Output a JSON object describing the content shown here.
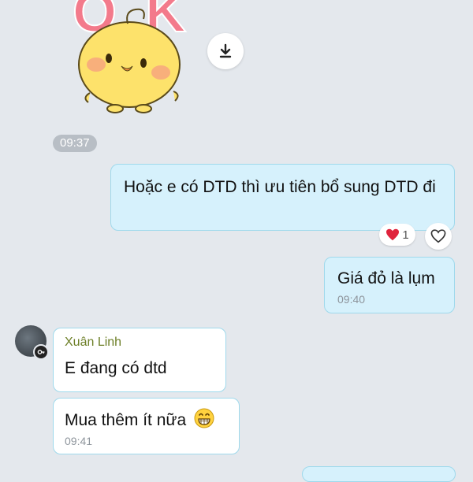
{
  "sticker": {
    "name": "ok-chick-sticker",
    "letters": "OK"
  },
  "download_icon": "download-icon",
  "divider_time": "09:37",
  "messages": [
    {
      "text": "Hoặc e có DTD thì ưu tiên bổ sung DTD đi"
    },
    {
      "text": "Giá đỏ là lụm",
      "time": "09:40"
    },
    {
      "sender": "Xuân Linh",
      "text": "E đang có dtd"
    },
    {
      "text": "Mua thêm ít nữa",
      "emoji": "grinning-face-icon",
      "time": "09:41"
    }
  ],
  "reaction": {
    "icon": "heart-icon",
    "count": "1"
  },
  "like_icon": "heart-outline-icon",
  "colors": {
    "mine_bubble": "#d6f1fc",
    "bubble_border": "#9fd9ec",
    "sender_name": "#6d7f27",
    "background": "#e4e8ed"
  }
}
